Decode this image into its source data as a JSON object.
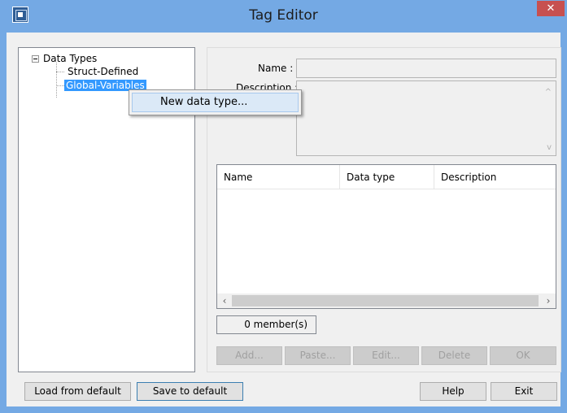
{
  "window": {
    "title": "Tag Editor",
    "close_glyph": "✕",
    "accent_color": "#74a9e4",
    "close_color": "#c75050"
  },
  "tree": {
    "root": "Data Types",
    "children": [
      {
        "label": "Struct-Defined"
      },
      {
        "label": "Global-Variables",
        "selected": true
      }
    ]
  },
  "context_menu": {
    "items": [
      {
        "label": "New data type..."
      }
    ]
  },
  "form": {
    "name_label": "Name :",
    "name_value": "",
    "description_label": "Description :",
    "description_value": ""
  },
  "members": {
    "columns": [
      "Name",
      "Data type",
      "Description"
    ],
    "rows": [],
    "count_text": "0 member(s)"
  },
  "member_buttons": {
    "add": "Add...",
    "paste": "Paste...",
    "edit": "Edit...",
    "delete": "Delete",
    "ok": "OK"
  },
  "footer": {
    "load_default": "Load from default",
    "save_default": "Save to default",
    "help": "Help",
    "exit": "Exit"
  },
  "icons": {
    "scroll_left": "‹",
    "scroll_right": "›",
    "scroll_up": "^",
    "scroll_down": "v"
  }
}
